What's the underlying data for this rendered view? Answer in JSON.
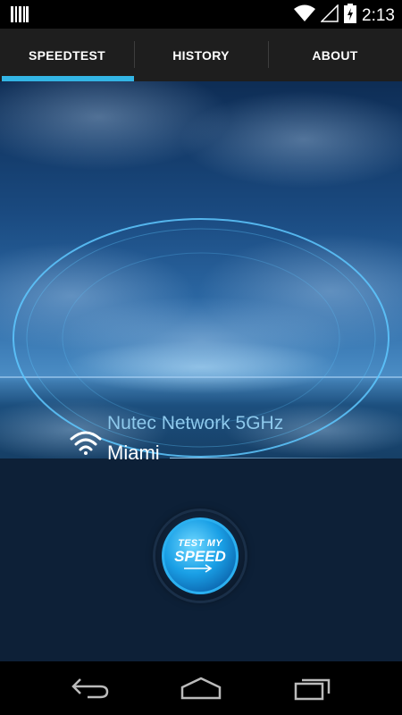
{
  "status_bar": {
    "time": "2:13",
    "icons": [
      "barcode-icon",
      "wifi-icon",
      "signal-icon",
      "battery-charging-icon"
    ]
  },
  "tabs": [
    {
      "label": "SPEEDTEST",
      "active": true
    },
    {
      "label": "HISTORY",
      "active": false
    },
    {
      "label": "ABOUT",
      "active": false
    }
  ],
  "network": {
    "name": "Nutec Network 5GHz",
    "city": "Miami",
    "icon": "wifi-icon"
  },
  "test_button": {
    "line1": "TEST MY",
    "line2": "SPEED"
  },
  "nav_bar": {
    "buttons": [
      "back-icon",
      "home-icon",
      "recent-apps-icon"
    ]
  },
  "colors": {
    "accent": "#33b5e5",
    "network_name": "#8ec9ec",
    "background": "#0d2037"
  }
}
